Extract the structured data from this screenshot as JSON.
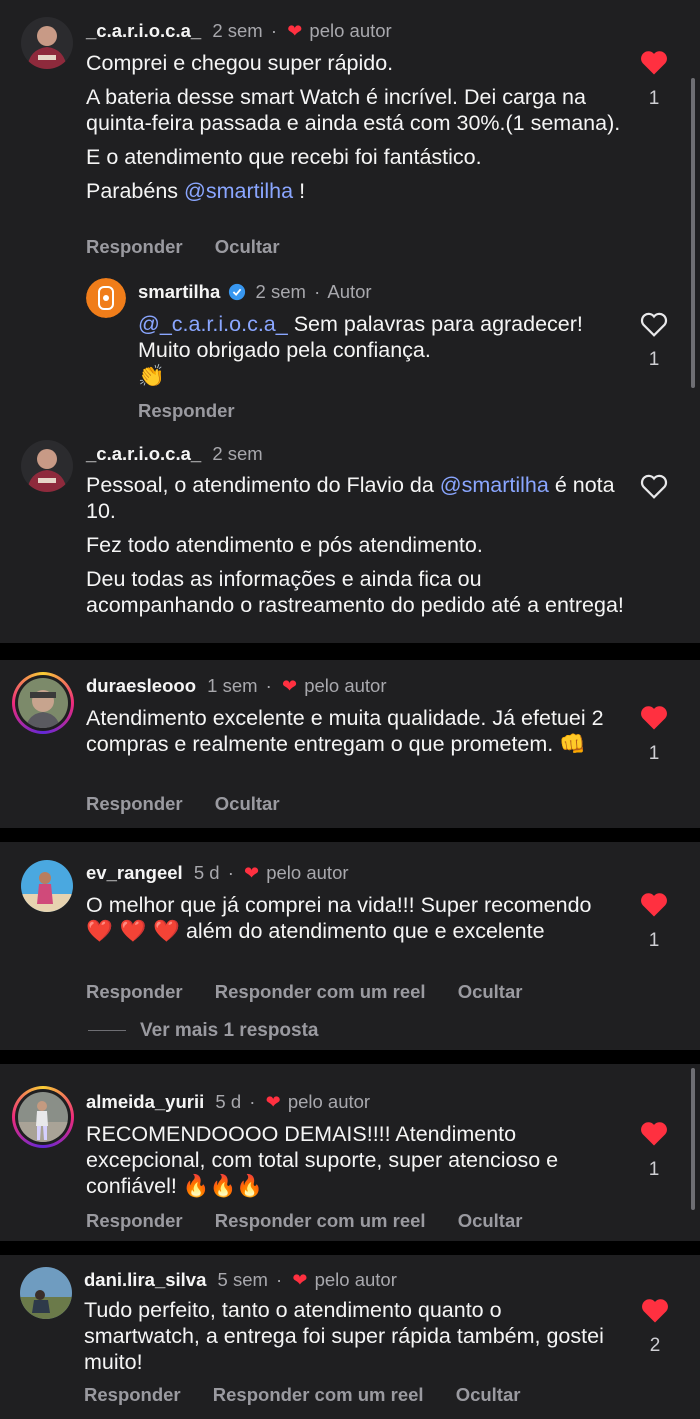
{
  "colors": {
    "background": "#1f1f21",
    "separator": "#000000",
    "heart_red": "#ff3040",
    "mention": "#8aa6ff",
    "muted": "#a8a8ad"
  },
  "comments": [
    {
      "username": "_c.a.r.i.o.c.a_",
      "time": "2 sem",
      "badge": "pelo autor",
      "lines": [
        "Comprei e chegou super rápido.",
        "A bateria desse smart Watch é incrível. Dei carga na quinta-feira passada e ainda está com 30%.(1 semana).",
        "E o atendimento que recebi foi fantástico."
      ],
      "last_prefix": "Parabéns",
      "last_mention": "@smartilha",
      "last_suffix": "!",
      "likes": "1",
      "liked": true,
      "actions": [
        "Responder",
        "Ocultar"
      ],
      "reply": {
        "username": "smartilha",
        "time": "2 sem",
        "badge": "Autor",
        "mention": "@_c.a.r.i.o.c.a_",
        "text": "Sem palavras para agradecer! Muito obrigado pela confiança.",
        "emoji": "👏",
        "likes": "1",
        "liked": false,
        "actions": [
          "Responder"
        ]
      }
    },
    {
      "username": "_c.a.r.i.o.c.a_",
      "time": "2 sem",
      "text_prefix": "Pessoal, o atendimento do Flavio da",
      "mention": "@smartilha",
      "text_suffix": "é nota 10.",
      "lines": [
        "Fez todo atendimento e pós atendimento.",
        "Deu todas as informações e ainda fica ou acompanhando o rastreamento do pedido até a entrega!"
      ],
      "liked": false
    },
    {
      "username": "duraesleooo",
      "time": "1 sem",
      "badge": "pelo autor",
      "text": "Atendimento excelente e muita qualidade. Já efetuei 2 compras e realmente entregam o que prometem.",
      "emoji": "👊",
      "likes": "1",
      "liked": true,
      "actions": [
        "Responder",
        "Ocultar"
      ]
    },
    {
      "username": "ev_rangeel",
      "time": "5 d",
      "badge": "pelo autor",
      "text_prefix": "O melhor que já comprei na vida!!! Super recomendo",
      "emoji": "❤️ ❤️ ❤️",
      "text_suffix": "além do atendimento que e excelente",
      "likes": "1",
      "liked": true,
      "actions": [
        "Responder",
        "Responder com um reel",
        "Ocultar"
      ],
      "view_more": "Ver mais 1 resposta"
    },
    {
      "username": "almeida_yurii",
      "time": "5 d",
      "badge": "pelo autor",
      "text": "RECOMENDOOOO DEMAIS!!!! Atendimento excepcional, com total suporte, super atencioso e confiável!",
      "emoji": "🔥🔥🔥",
      "likes": "1",
      "liked": true,
      "actions": [
        "Responder",
        "Responder com um reel",
        "Ocultar"
      ]
    },
    {
      "username": "dani.lira_silva",
      "time": "5 sem",
      "badge": "pelo autor",
      "text": "Tudo perfeito, tanto o atendimento quanto o smartwatch, a entrega foi super rápida também, gostei muito!",
      "likes": "2",
      "liked": true,
      "actions": [
        "Responder",
        "Responder com um reel",
        "Ocultar"
      ]
    }
  ]
}
